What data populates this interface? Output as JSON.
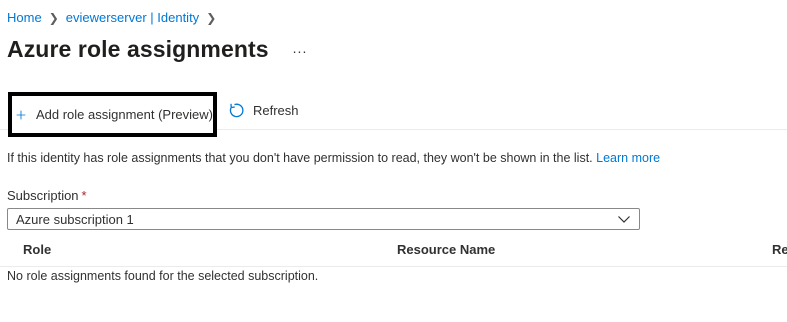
{
  "breadcrumb": {
    "items": [
      "Home",
      "eviewerserver | Identity"
    ]
  },
  "header": {
    "title": "Azure role assignments",
    "more_label": "..."
  },
  "toolbar": {
    "add_label": "Add role assignment (Preview)",
    "refresh_label": "Refresh"
  },
  "info": {
    "text": "If this identity has role assignments that you don't have permission to read, they won't be shown in the list.",
    "link": "Learn more"
  },
  "subscription": {
    "label": "Subscription",
    "required_mark": "*",
    "value": "Azure subscription 1"
  },
  "table": {
    "columns": [
      "Role",
      "Resource Name",
      "Re"
    ],
    "empty_message": "No role assignments found for the selected subscription."
  },
  "colors": {
    "link": "#0078d4",
    "required": "#a4262c",
    "highlight_border": "#000000"
  },
  "icons": [
    "chevron-right-icon",
    "more-icon",
    "plus-icon",
    "refresh-icon",
    "chevron-down-icon"
  ]
}
